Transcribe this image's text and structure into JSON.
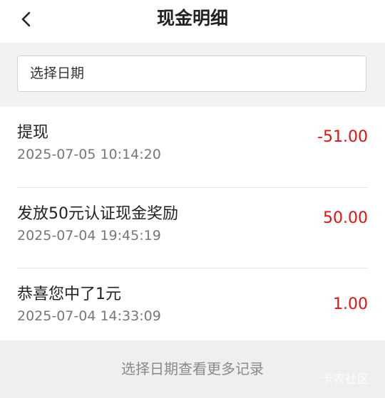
{
  "header": {
    "title": "现金明细",
    "back_icon": "chevron-left-icon"
  },
  "filter": {
    "placeholder": "选择日期"
  },
  "records": [
    {
      "title": "提现",
      "time": "2025-07-05 10:14:20",
      "amount": "-51.00"
    },
    {
      "title": "发放50元认证现金奖励",
      "time": "2025-07-04 19:45:19",
      "amount": "50.00"
    },
    {
      "title": "恭喜您中了1元",
      "time": "2025-07-04 14:33:09",
      "amount": "1.00"
    }
  ],
  "footer": {
    "more_label": "选择日期查看更多记录",
    "watermark": "卡农社区"
  },
  "colors": {
    "amount": "#e01212",
    "background": "#f2f2f2"
  }
}
